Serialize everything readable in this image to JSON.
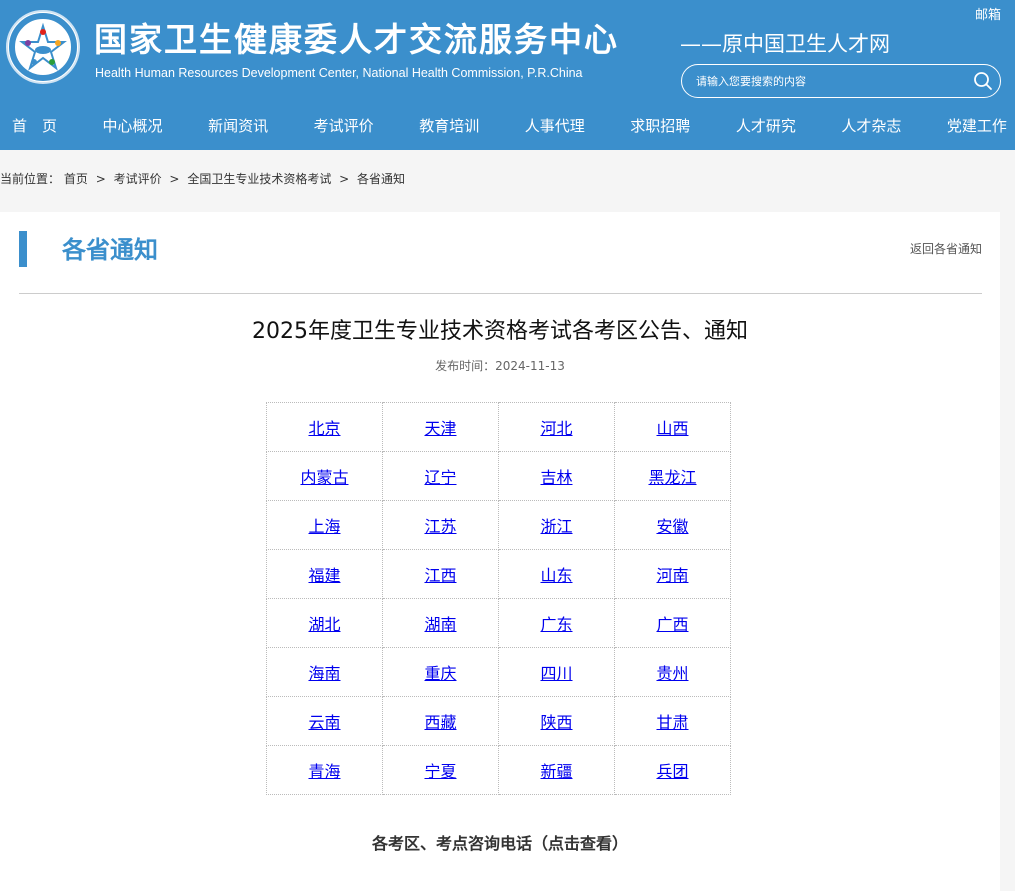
{
  "header": {
    "site_title": "国家卫生健康委人才交流服务中心",
    "site_subtitle": "Health Human Resources Development Center, National Health Commission, P.R.China",
    "slogan": "——原中国卫生人才网",
    "mail_label": "邮箱",
    "search_placeholder": "请输入您要搜索的内容",
    "search_icon": "search-icon",
    "brand_color": "#3b8fcc"
  },
  "nav": [
    {
      "label": "首　页"
    },
    {
      "label": "中心概况"
    },
    {
      "label": "新闻资讯"
    },
    {
      "label": "考试评价"
    },
    {
      "label": "教育培训"
    },
    {
      "label": "人事代理"
    },
    {
      "label": "求职招聘"
    },
    {
      "label": "人才研究"
    },
    {
      "label": "人才杂志"
    },
    {
      "label": "党建工作"
    }
  ],
  "breadcrumb": {
    "prefix": "当前位置：",
    "items": [
      "首页",
      "考试评价",
      "全国卫生专业技术资格考试",
      "各省通知"
    ],
    "separator": ">"
  },
  "panel": {
    "title": "各省通知",
    "back_link": "返回各省通知"
  },
  "article": {
    "title": "2025年度卫生专业技术资格考试各考区公告、通知",
    "publish_label": "发布时间：",
    "publish_date": "2024-11-13",
    "consult_text": "各考区、考点咨询电话（点击查看）"
  },
  "provinces": [
    [
      "北京",
      "天津",
      "河北",
      "山西"
    ],
    [
      "内蒙古",
      "辽宁",
      "吉林",
      "黑龙江"
    ],
    [
      "上海",
      "江苏",
      "浙江",
      "安徽"
    ],
    [
      "福建",
      "江西",
      "山东",
      "河南"
    ],
    [
      "湖北",
      "湖南",
      "广东",
      "广西"
    ],
    [
      "海南",
      "重庆",
      "四川",
      "贵州"
    ],
    [
      "云南",
      "西藏",
      "陕西",
      "甘肃"
    ],
    [
      "青海",
      "宁夏",
      "新疆",
      "兵团"
    ]
  ]
}
